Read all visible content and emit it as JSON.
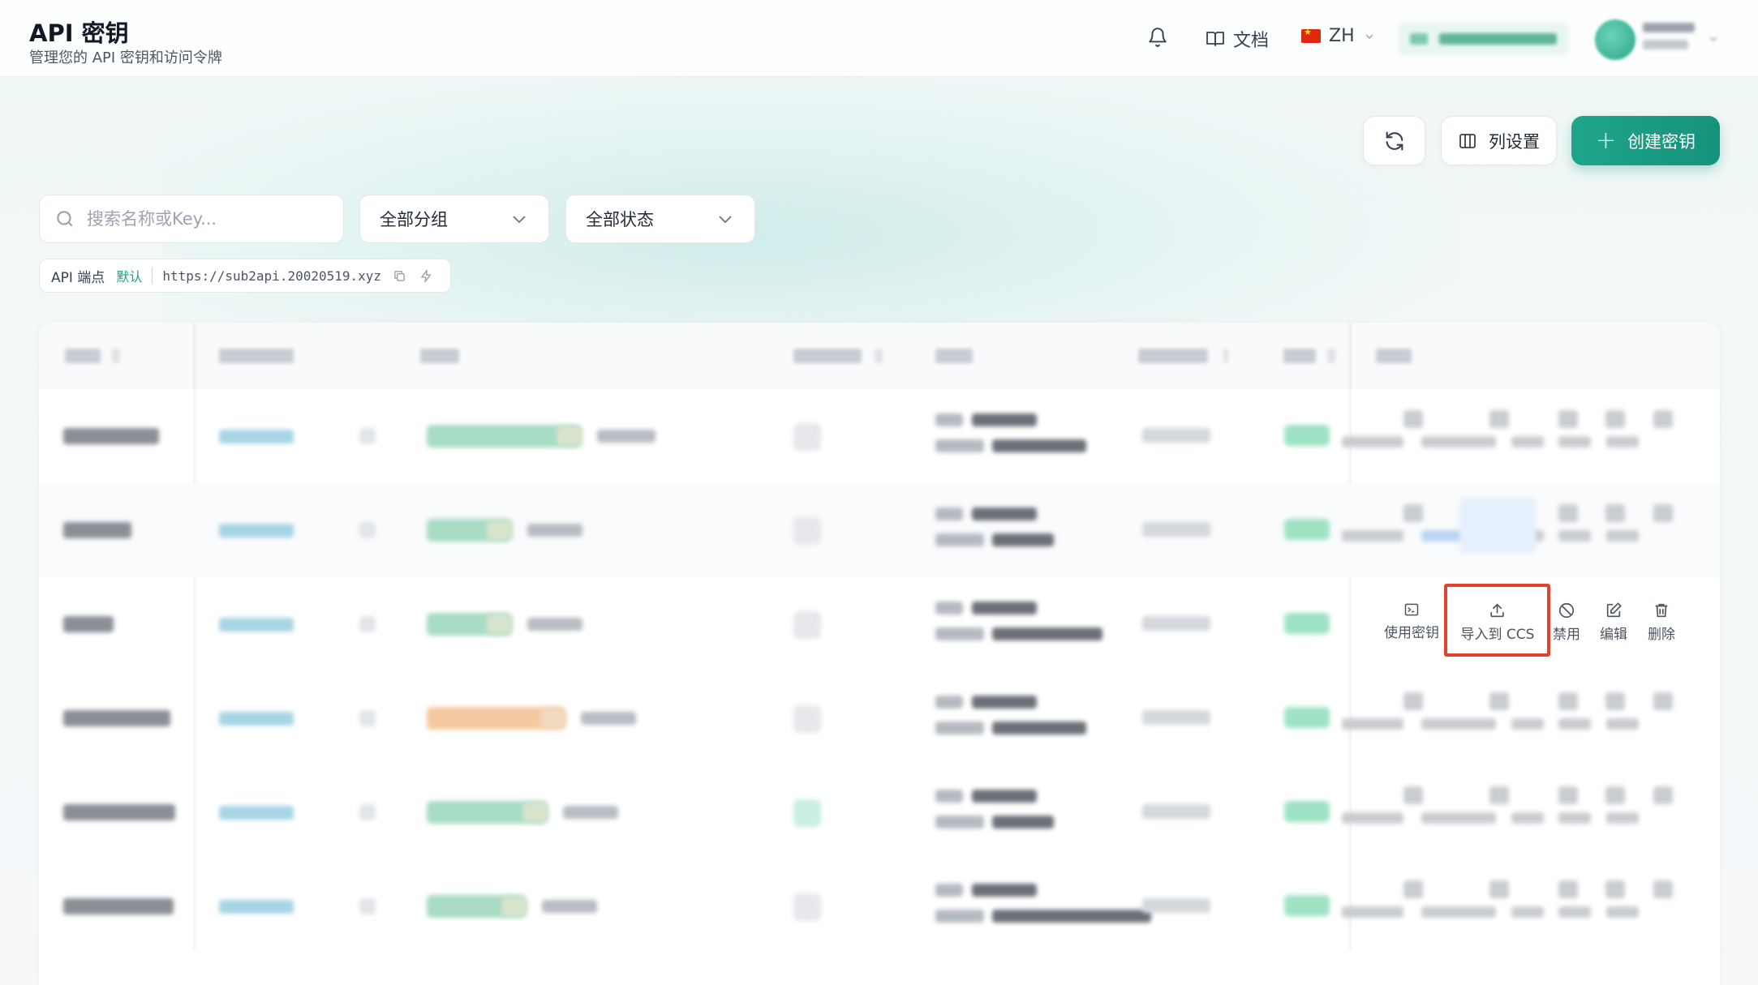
{
  "header": {
    "title": "API 密钥",
    "subtitle": "管理您的 API 密钥和访问令牌",
    "docs_label": "文档",
    "lang_label": "ZH"
  },
  "toolbar": {
    "columns_label": "列设置",
    "create_label": "创建密钥"
  },
  "filters": {
    "search_placeholder": "搜索名称或Key...",
    "group_value": "全部分组",
    "status_value": "全部状态"
  },
  "endpoint": {
    "label": "API 端点",
    "badge": "默认",
    "url": "https://sub2api.20020519.xyz"
  },
  "row_actions": {
    "use_key": "使用密钥",
    "import_ccs": "导入到 CCS",
    "disable": "禁用",
    "edit": "编辑",
    "delete": "删除"
  },
  "colors": {
    "accent": "#1a9c83",
    "highlight": "#e0432f"
  }
}
